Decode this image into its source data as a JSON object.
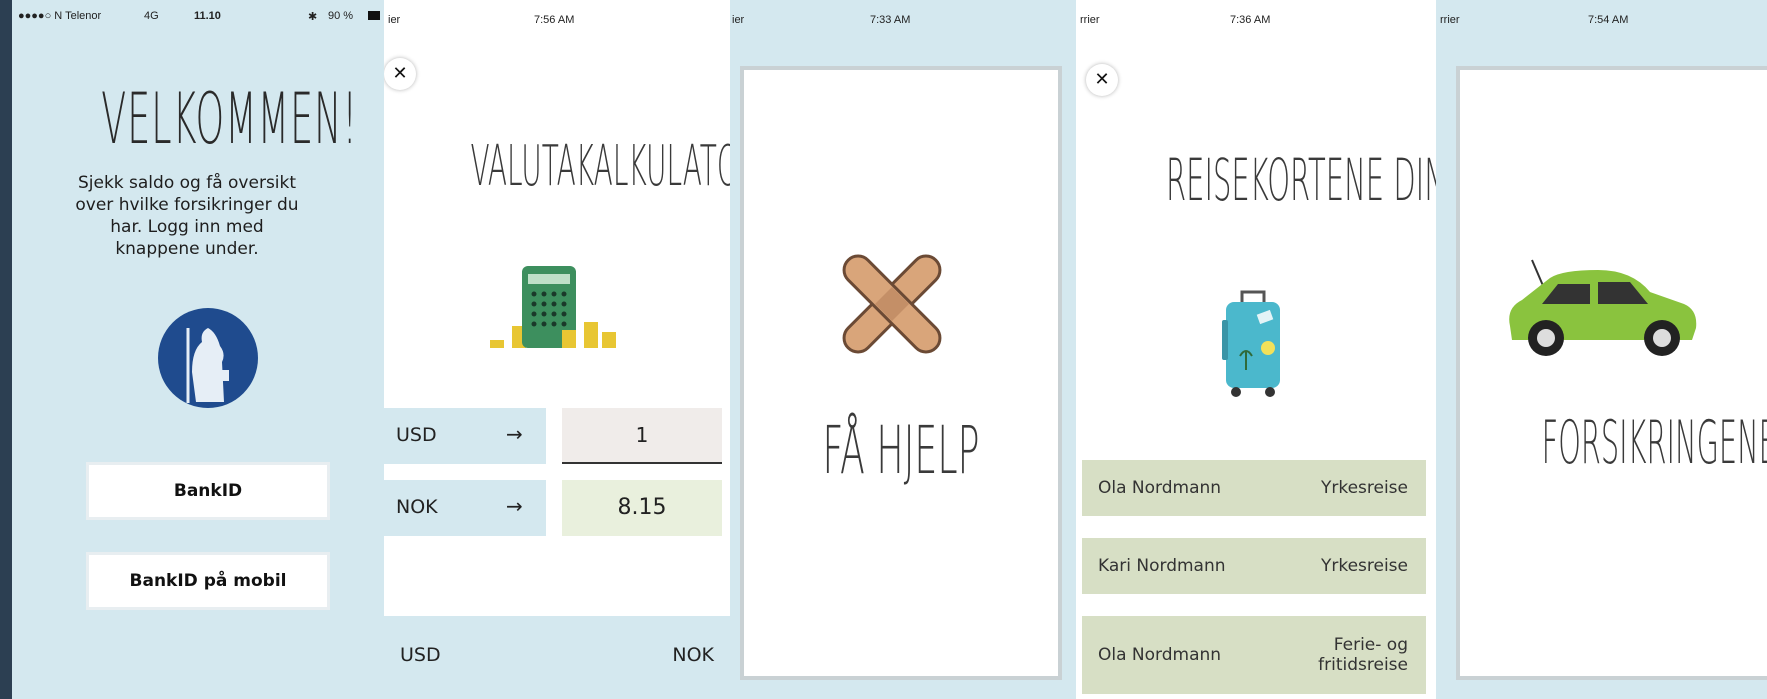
{
  "colors": {
    "bg": "#2c3f52",
    "panel_light": "#d4e8ef",
    "accent_green": "#8ac33e",
    "teal": "#48b8c9"
  },
  "p1": {
    "status": {
      "carrier": "●●●●○ N Telenor",
      "network": "4G",
      "time": "11.10",
      "bluetooth": "✱",
      "battery": "90 %"
    },
    "title": "VELKOMMEN!",
    "intro": "Sjekk saldo og få oversikt over hvilke forsikringer du har. Logg inn med knappene under.",
    "logo_icon": "guard-figure-icon",
    "btn_bankid": "BankID",
    "btn_bankid_mobile": "BankID på mobil"
  },
  "p2": {
    "status": {
      "carrier": "ier",
      "time": "7:56 AM"
    },
    "close": "✕",
    "title": "VALUTAKALKULATOR",
    "icon": "calculator-coins-icon",
    "from_code": "USD",
    "arrow": "→",
    "from_value": "1",
    "to_code": "NOK",
    "to_value": "8.15",
    "bottom_left": "USD",
    "bottom_right": "NOK"
  },
  "p3": {
    "status": {
      "carrier": "ier",
      "time": "7:33 AM"
    },
    "icon": "bandage-cross-icon",
    "title": "FÅ HJELP"
  },
  "p4": {
    "status": {
      "carrier": "rrier",
      "time": "7:36 AM"
    },
    "close": "✕",
    "title": "REISEKORTENE DINE",
    "icon": "suitcase-icon",
    "rows": [
      {
        "name": "Ola Nordmann",
        "type": "Yrkesreise"
      },
      {
        "name": "Kari Nordmann",
        "type": "Yrkesreise"
      },
      {
        "name": "Ola Nordmann",
        "type": "Ferie- og fritidsreise"
      }
    ]
  },
  "p5": {
    "status": {
      "carrier": "rrier",
      "time": "7:54 AM"
    },
    "icon": "car-icon",
    "title": "FORSIKRINGENE DINE"
  }
}
